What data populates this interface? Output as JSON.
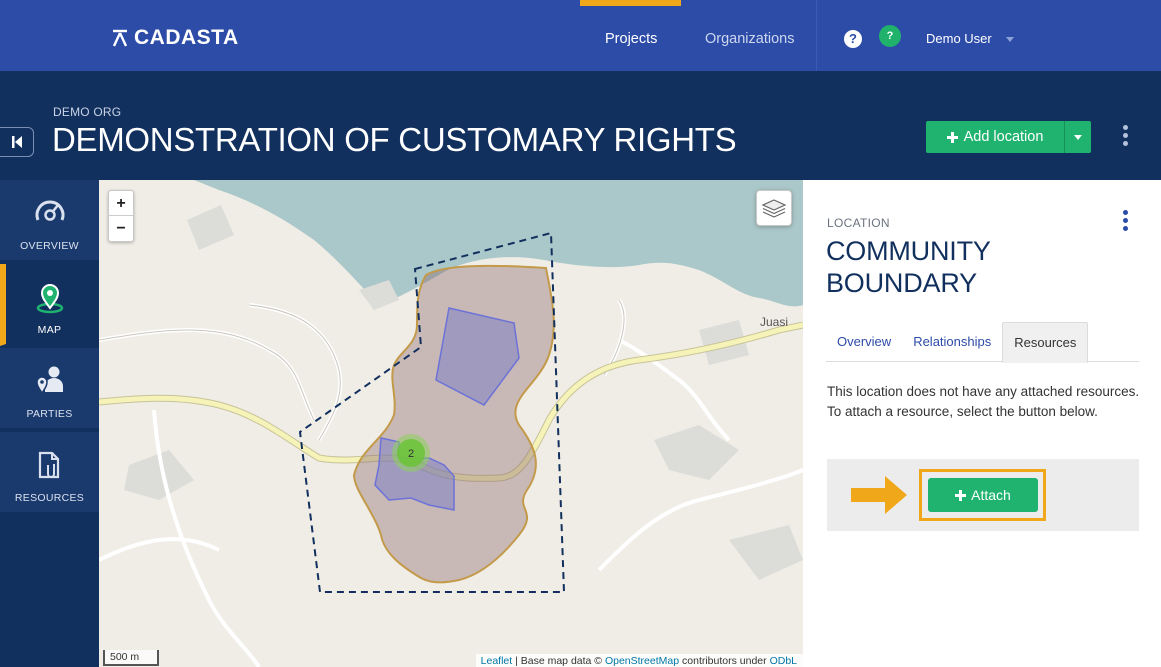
{
  "brand": {
    "name": "CADASTA"
  },
  "nav": {
    "projects": "Projects",
    "organizations": "Organizations",
    "help_badge": "?",
    "user": "Demo User"
  },
  "header": {
    "org": "DEMO ORG",
    "project": "DEMONSTRATION OF CUSTOMARY RIGHTS",
    "add_location": "Add location"
  },
  "sidebar": {
    "items": [
      {
        "label": "OVERVIEW"
      },
      {
        "label": "MAP"
      },
      {
        "label": "PARTIES"
      },
      {
        "label": "RESOURCES"
      }
    ]
  },
  "map": {
    "zoom_in": "+",
    "zoom_out": "−",
    "place_label": "Juasi",
    "cluster_count": "2",
    "scale": "500 m",
    "attribution": {
      "leaflet": "Leaflet",
      "sep": " | Base map data © ",
      "osm": "OpenStreetMap",
      "under": " contributors under ",
      "license": "ODbL"
    }
  },
  "panel": {
    "type": "LOCATION",
    "name": "COMMUNITY BOUNDARY",
    "tabs": [
      "Overview",
      "Relationships",
      "Resources"
    ],
    "active_tab": "Resources",
    "empty_message": "This location does not have any attached resources. To attach a resource, select the button below.",
    "attach": "Attach"
  },
  "colors": {
    "nav_bg": "#2d4ca8",
    "header_bg": "#12305e",
    "accent": "#f0a81a",
    "primary_green": "#1fb36f"
  }
}
